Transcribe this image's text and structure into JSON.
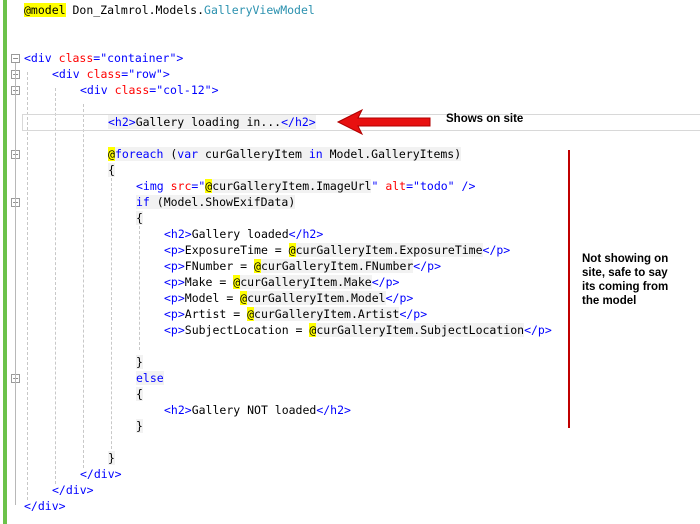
{
  "editor": {
    "model_directive": "@model",
    "model_type_ns": " Don_Zalmrol.Models.",
    "model_type_name": "GalleryViewModel",
    "lines": {
      "div_container": [
        "<div",
        " ",
        "class",
        "=",
        "\"container\"",
        ">"
      ],
      "div_row": [
        "<div",
        " ",
        "class",
        "=",
        "\"row\"",
        ">"
      ],
      "div_col": [
        "<div",
        " ",
        "class",
        "=",
        "\"col-12\"",
        ">"
      ],
      "h2_loading_open": "<h2>",
      "h2_loading_text": "Gallery loading in...",
      "h2_loading_close": "</h2>",
      "foreach_at": "@",
      "foreach_kw": "foreach",
      "foreach_rest1": " (",
      "foreach_var": "var",
      "foreach_rest2": " curGalleryItem ",
      "foreach_in": "in",
      "foreach_rest3": " Model.GalleryItems)",
      "brace_open": "{",
      "brace_close": "}",
      "img_tag": "<img",
      "img_src_attr": " src",
      "img_eq1": "=",
      "img_src_q1": "\"",
      "img_src_razor": "@",
      "img_src_expr": "curGalleryItem.ImageUrl",
      "img_src_q2": "\"",
      "img_alt_attr": " alt",
      "img_eq2": "=",
      "img_alt_val": "\"todo\"",
      "img_close": " />",
      "if_kw": "if",
      "if_rest": " (Model.ShowExifData)",
      "h2_loaded": "Gallery loaded",
      "p_exposure_label": "ExposureTime = ",
      "p_exposure_expr": "curGalleryItem.ExposureTime",
      "p_fnumber_label": "FNumber = ",
      "p_fnumber_expr": "curGalleryItem.FNumber",
      "p_make_label": "Make = ",
      "p_make_expr": "curGalleryItem.Make",
      "p_model_label": "Model = ",
      "p_model_expr": "curGalleryItem.Model",
      "p_artist_label": "Artist = ",
      "p_artist_expr": "curGalleryItem.Artist",
      "p_subject_label": "SubjectLocation = ",
      "p_subject_expr": "curGalleryItem.SubjectLocation",
      "else_kw": "else",
      "h2_not_loaded": "Gallery NOT loaded",
      "close_div": "</div>",
      "h2_open": "<h2>",
      "h2_close": "</h2>",
      "p_open": "<p>",
      "p_close": "</p>",
      "at": "@"
    }
  },
  "annotations": {
    "shows_on_site": "Shows on site",
    "not_showing": [
      "Not showing on",
      "site, safe to say",
      "its coming from",
      "the model"
    ],
    "arrow_color": "#e81010",
    "line_color": "#c00000"
  },
  "colors": {
    "gutter": "#6cc24a",
    "razor_highlight": "#ffff00",
    "keyword": "#0000ff",
    "tag": "#800000",
    "attribute": "#ff0000"
  }
}
